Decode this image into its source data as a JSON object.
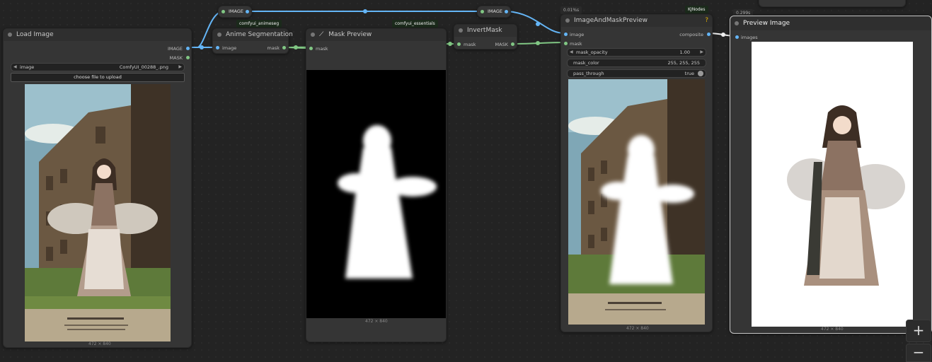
{
  "colors": {
    "image_link": "#64b5f6",
    "mask_link": "#81c784",
    "canvas": "#232323",
    "node": "#353535"
  },
  "reroutes": [
    {
      "label": "IMAGE"
    },
    {
      "label": "IMAGE"
    }
  ],
  "badges": {
    "animeseg": "comfyui_animeseg",
    "essentials": "comfyui_essentials",
    "kjnodes": "KJNodes",
    "time_overlay": "0.01%s",
    "time_preview": "0.299s"
  },
  "load_image": {
    "title": "Load Image",
    "out_image": "IMAGE",
    "out_mask": "MASK",
    "widget_label": "image",
    "widget_value": "ComfyUI_00288_.png",
    "upload_label": "choose file to upload",
    "dims": "472 × 840"
  },
  "anime_seg": {
    "title": "Anime Segmentation",
    "in_image": "image",
    "out_mask": "mask"
  },
  "mask_preview": {
    "icon": "magic-wand-icon",
    "title": "Mask Preview",
    "in_mask": "mask",
    "dims": "472 × 840"
  },
  "invert_mask": {
    "title": "InvertMask",
    "in_mask": "mask",
    "out_mask": "MASK"
  },
  "overlay": {
    "title": "ImageAndMaskPreview",
    "help": "?",
    "in_image": "image",
    "in_mask": "mask",
    "out_composite": "composite",
    "opacity_label": "mask_opacity",
    "opacity_value": "1.00",
    "color_label": "mask_color",
    "color_value": "255, 255, 255",
    "pass_label": "pass_through",
    "pass_value": "true",
    "dims": "472 × 840"
  },
  "preview": {
    "title": "Preview Image",
    "in_images": "images",
    "dims": "472 × 840"
  },
  "zoom": {
    "in": "+",
    "out": "−"
  }
}
